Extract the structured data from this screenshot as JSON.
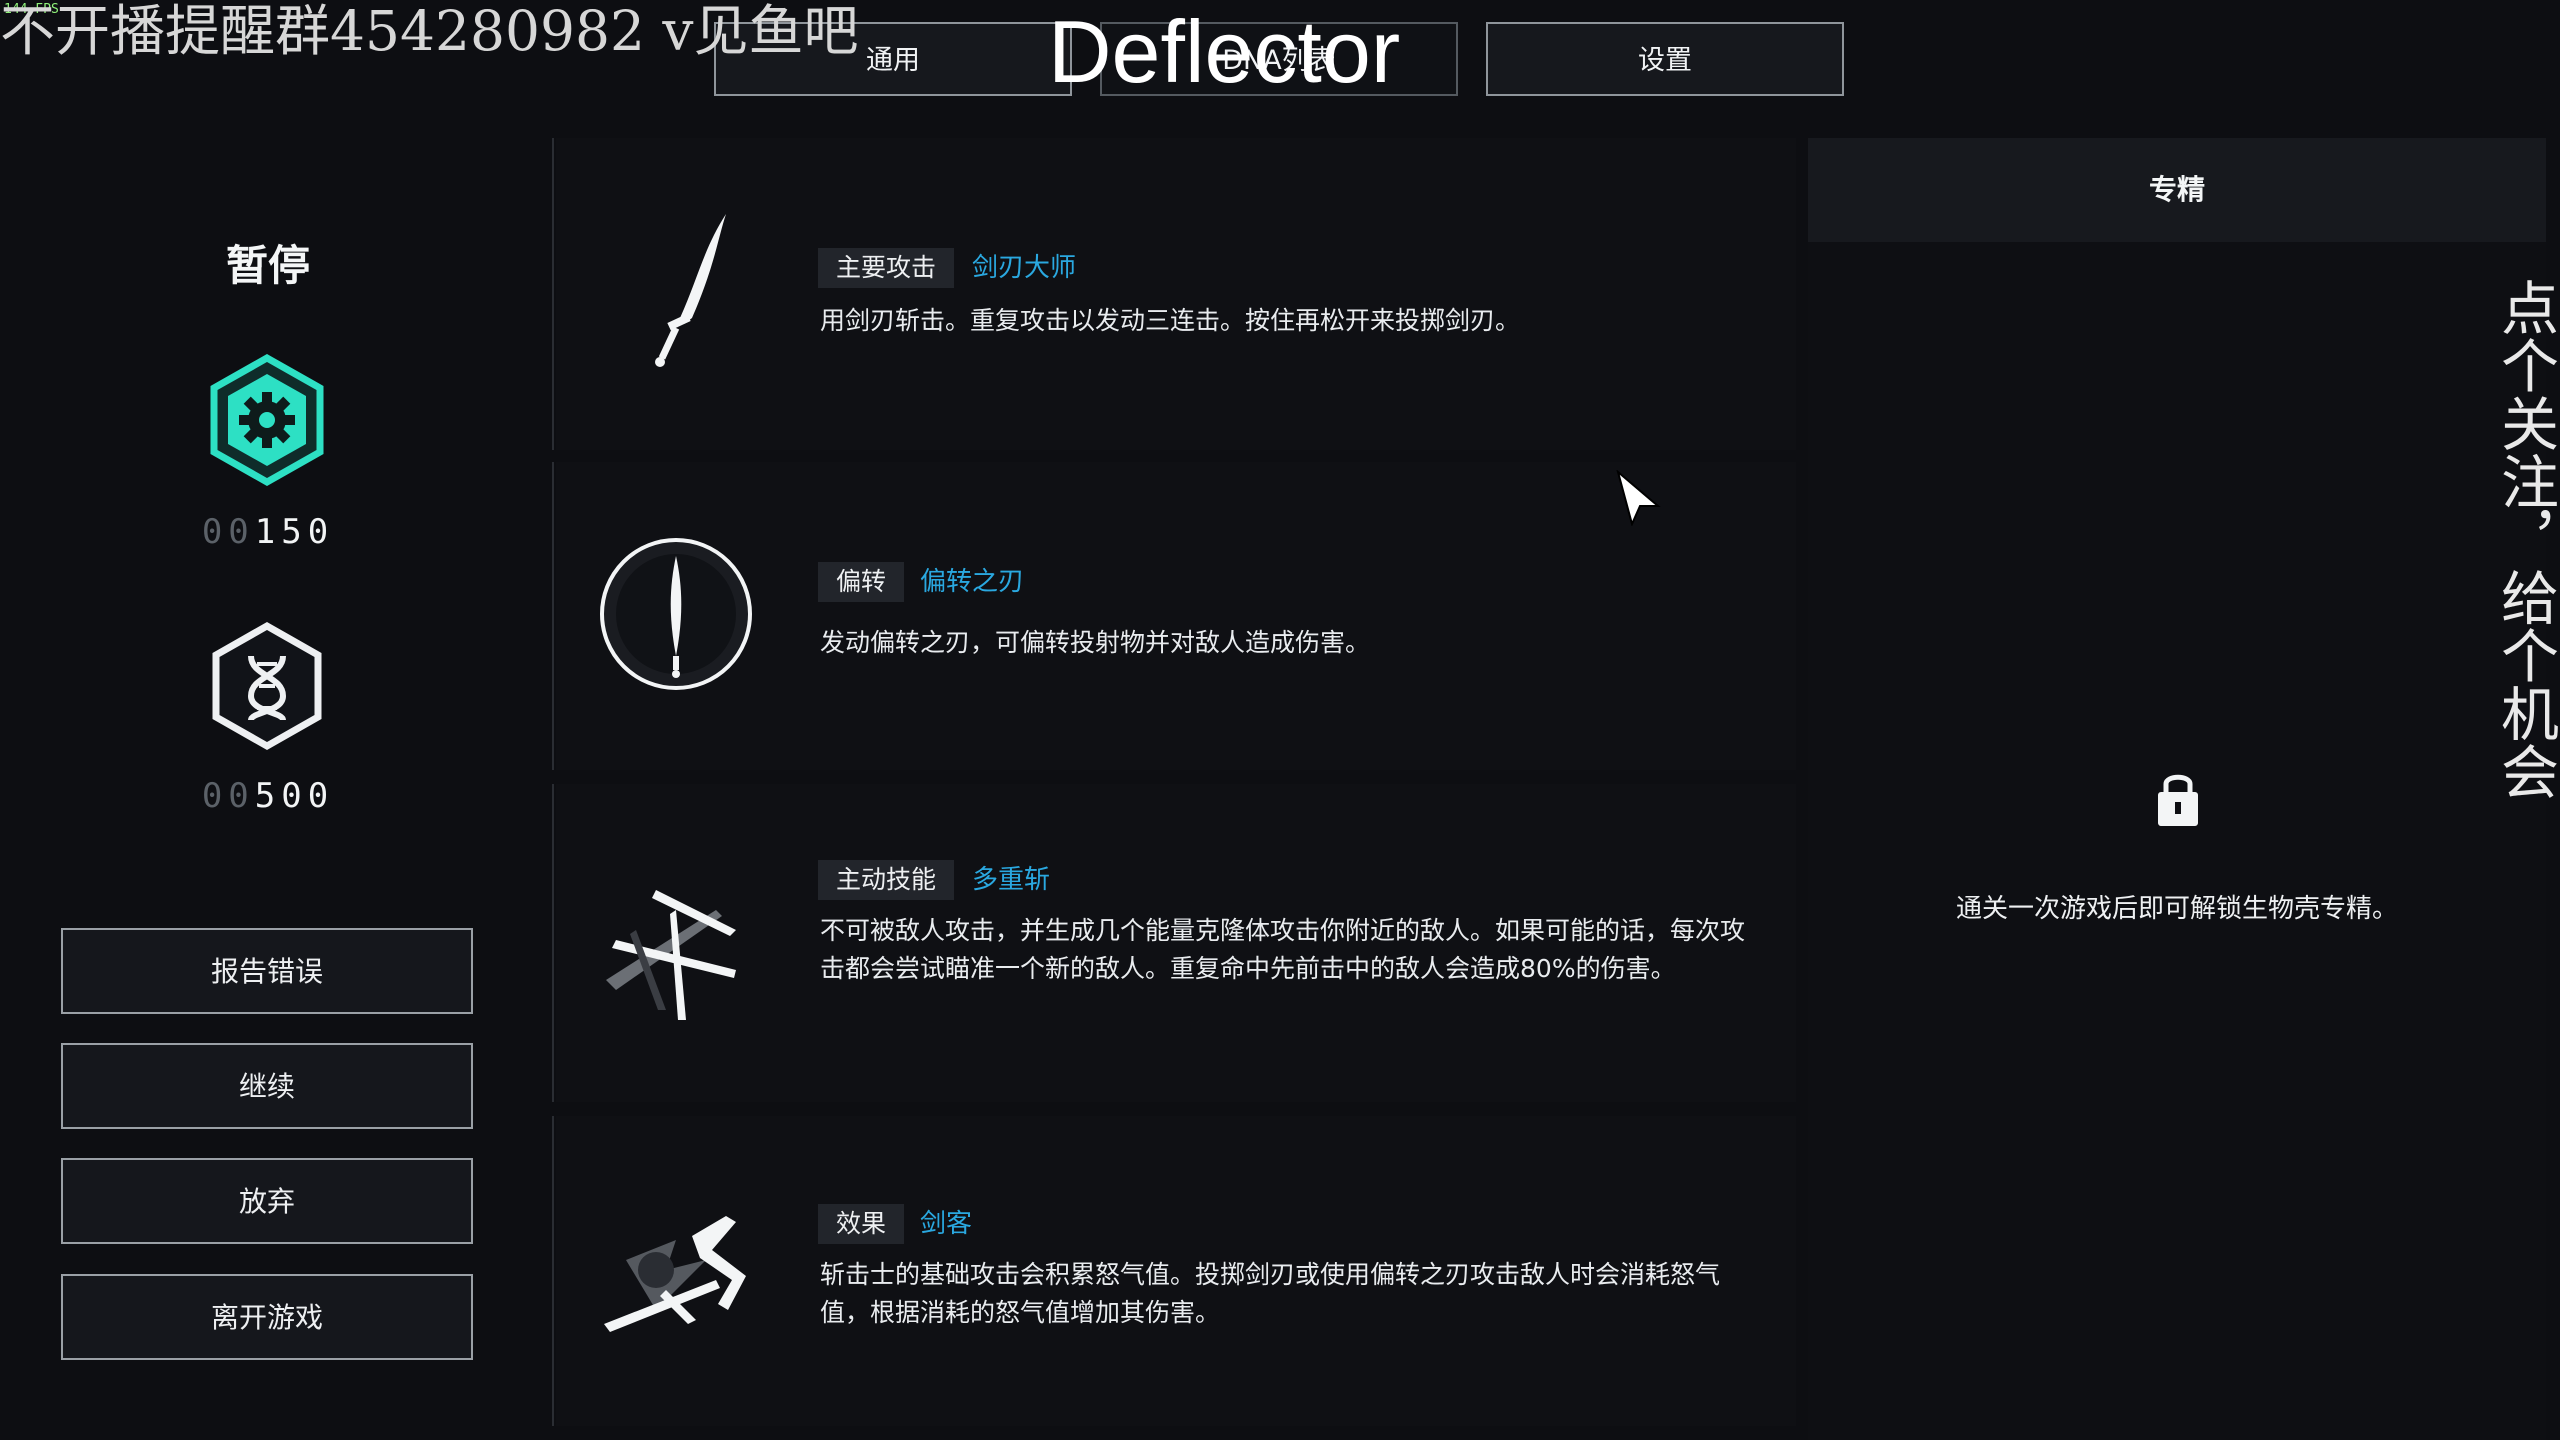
{
  "overlay": {
    "fps": "144 FPS",
    "stream_note": "不开播提醒群454280982 v见鱼吧",
    "big_title": "Deflector",
    "vertical_note": "点个关注，给个机会"
  },
  "tabs": [
    {
      "label": "通用",
      "active": false
    },
    {
      "label": "DNA列表",
      "active": true
    },
    {
      "label": "设置",
      "active": false
    }
  ],
  "left": {
    "title": "暂停",
    "counters": [
      {
        "icon": "gear-currency-icon",
        "prefix": "00",
        "value": "150",
        "color": "#2de0c4"
      },
      {
        "icon": "dna-currency-icon",
        "prefix": "00",
        "value": "500",
        "color": "#e8ecef"
      }
    ],
    "buttons": [
      "报告错误",
      "继续",
      "放弃",
      "离开游戏"
    ]
  },
  "cards": [
    {
      "icon": "blade-icon",
      "tag": "主要攻击",
      "name": "剑刃大师",
      "desc": "用剑刃斩击。重复攻击以发动三连击。按住再松开来投掷剑刃。"
    },
    {
      "icon": "deflect-shield-icon",
      "tag": "偏转",
      "name": "偏转之刃",
      "desc": "发动偏转之刃，可偏转投射物并对敌人造成伤害。"
    },
    {
      "icon": "multi-slash-icon",
      "tag": "主动技能",
      "name": "多重斩",
      "desc": "不可被敌人攻击，并生成几个能量克隆体攻击你附近的敌人。如果可能的话，每次攻击都会尝试瞄准一个新的敌人。重复命中先前击中的敌人会造成80%的伤害。"
    },
    {
      "icon": "swordsman-effect-icon",
      "tag": "效果",
      "name": "剑客",
      "desc": "斩击士的基础攻击会积累怒气值。投掷剑刃或使用偏转之刃攻击敌人时会消耗怒气值，根据消耗的怒气值增加其伤害。"
    }
  ],
  "right": {
    "header": "专精",
    "lock_icon": "lock-icon",
    "unlock_text": "通关一次游戏后即可解锁生物壳专精。"
  },
  "colors": {
    "accent_teal": "#2de0c4",
    "name_blue": "#2aa8e0",
    "background": "#0d0e12"
  }
}
